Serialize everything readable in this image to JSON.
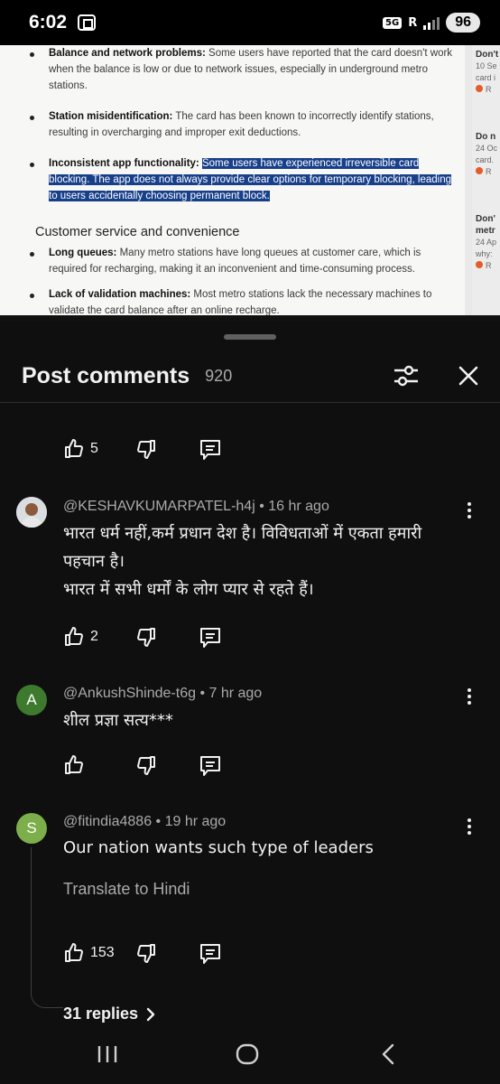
{
  "status_bar": {
    "time": "6:02",
    "network": "5G",
    "roaming": "R",
    "battery": "96"
  },
  "document": {
    "items": [
      {
        "bold": "Balance and network problems:",
        "text": " Some users have reported that the card doesn't work when the balance is low or due to network issues, especially in underground metro stations."
      },
      {
        "bold": "Station misidentification:",
        "text": " The card has been known to incorrectly identify stations, resulting in overcharging and improper exit deductions."
      },
      {
        "bold": "Inconsistent app functionality:",
        "highlight": "Some users have experienced irreversible card blocking. The app does not always provide clear options for temporary blocking, leading to users accidentally choosing permanent block."
      },
      {
        "bold": "Long queues:",
        "text": " Many metro stations have long queues at customer care, which is required for recharging, making it an inconvenient and time-consuming process."
      },
      {
        "bold": "Lack of validation machines:",
        "text": " Most metro stations lack the necessary machines to validate the card balance after an online recharge."
      }
    ],
    "section_heading": "Customer service and convenience",
    "side_cards": [
      {
        "title": "Don't",
        "line1": "10 Se",
        "line2": "card i"
      },
      {
        "title": "Do n",
        "line1": "24 Oc",
        "line2": "card."
      },
      {
        "title": "Don'",
        "line0": "metr",
        "line1": "24 Ap",
        "line2": "why:"
      }
    ]
  },
  "sheet": {
    "title": "Post comments",
    "count": "920",
    "close_icon": "close-icon",
    "filter_icon": "sliders-icon"
  },
  "comments": [
    {
      "author": "",
      "likes": "5"
    },
    {
      "author": "@KESHAVKUMARPATEL-h4j",
      "time": "16 hr ago",
      "meta": "@KESHAVKUMARPATEL-h4j • 16 hr ago",
      "lines": [
        "भारत धर्म नहीं,कर्म प्रधान देश है। विविधताओं में एकता हमारी",
        "पहचान है।",
        "भारत में सभी धर्मों के लोग प्यार से रहते हैं।"
      ],
      "likes": "2"
    },
    {
      "author": "@AnkushShinde-t6g",
      "avatar_letter": "A",
      "avatar_color": "#3d7a2e",
      "meta": "@AnkushShinde-t6g • 7 hr ago",
      "lines": [
        "शील प्रज्ञा सत्य***"
      ],
      "likes": ""
    },
    {
      "author": "@fitindia4886",
      "avatar_letter": "S",
      "avatar_color": "#7cae4a",
      "meta": "@fitindia4886 • 19 hr ago",
      "lines": [
        "Our nation wants such type of leaders"
      ],
      "translate": "Translate to Hindi",
      "likes": "153",
      "replies": "31 replies"
    }
  ],
  "nav": {
    "recents_icon": "recents-icon",
    "home_icon": "home-icon",
    "back_icon": "back-icon"
  }
}
